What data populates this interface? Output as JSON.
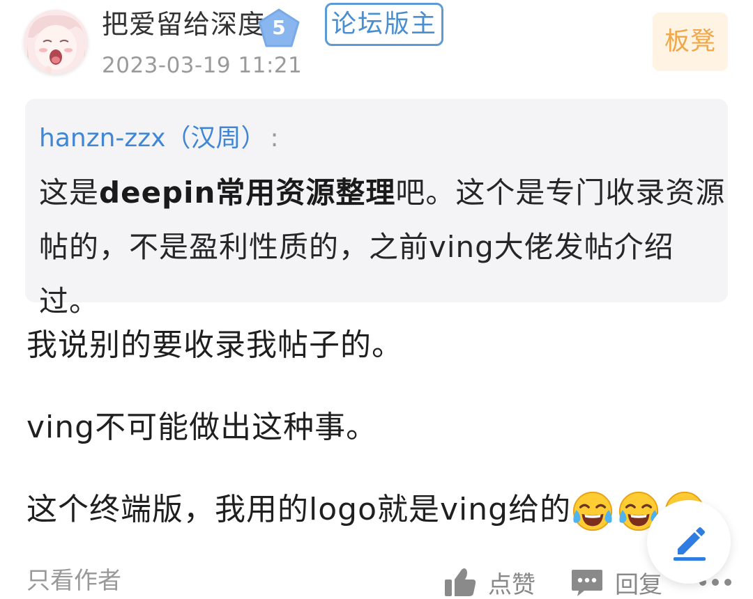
{
  "post": {
    "username": "把爱留给深度",
    "level": "5",
    "role": "论坛版主",
    "timestamp": "2023-03-19 11:21",
    "floor": "板凳"
  },
  "quote": {
    "author": "hanzn-zzx（汉周）",
    "colon": ":",
    "text_before": "这是",
    "text_bold": "deepin常用资源整理",
    "text_after": "吧。这个是专门收录资源帖的，不是盈利性质的，之前ving大佬发帖介绍过。"
  },
  "body": {
    "paragraph1": "我说别的要收录我帖子的。",
    "paragraph2": "ving不可能做出这种事。",
    "paragraph3": "这个终端版，我用的logo就是ving给的",
    "emoji_name": "face-with-tears-of-joy",
    "emoji_count": 3
  },
  "footer": {
    "only_author": "只看作者",
    "like": "点赞",
    "reply": "回复"
  },
  "colors": {
    "link_blue": "#3f86d6",
    "badge_blue": "#7aa9e8",
    "floor_orange": "#f0a74a",
    "quote_bg": "#f4f4f6"
  },
  "icons": {
    "level_badge": "pentagon-badge-icon",
    "like": "thumbs-up-icon",
    "reply": "chat-bubble-icon",
    "more": "more-dots-icon",
    "compose": "pencil-icon"
  }
}
